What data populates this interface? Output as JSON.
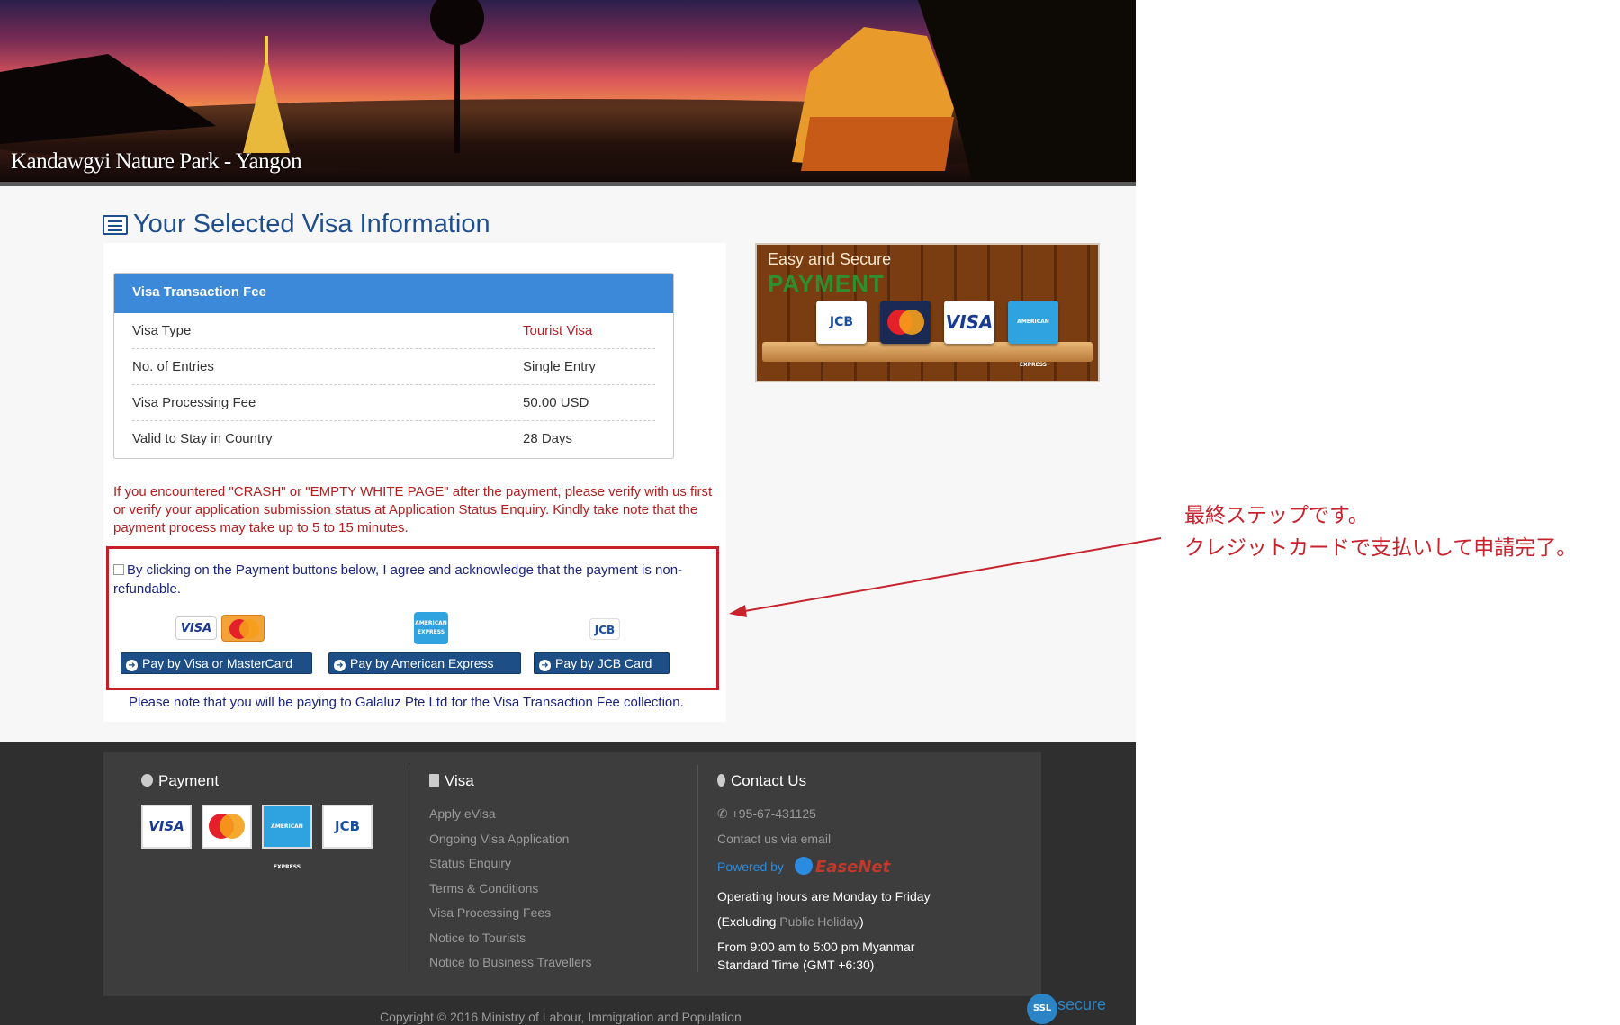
{
  "banner": {
    "caption": "Kandawgyi Nature Park - Yangon"
  },
  "section": {
    "title": "Your Selected Visa Information"
  },
  "fee_table": {
    "header": "Visa Transaction Fee",
    "rows": [
      {
        "label": "Visa Type",
        "value": "Tourist Visa"
      },
      {
        "label": "No. of Entries",
        "value": "Single Entry"
      },
      {
        "label": "Visa Processing Fee",
        "value": "50.00 USD"
      },
      {
        "label": "Valid to Stay in Country",
        "value": "28 Days"
      }
    ]
  },
  "warning_text": "If you encountered \"CRASH\" or \"EMPTY WHITE PAGE\" after the payment, please verify with us first or verify your application submission status at Application Status Enquiry. Kindly take note that the payment process may take up to 5 to 15 minutes.",
  "agreement_text": "By clicking on the Payment buttons below, I agree and acknowledge that the payment is non-refundable.",
  "payment": {
    "logos": {
      "visa": "VISA",
      "mastercard": "MasterCard",
      "amex": "AMERICAN EXPRESS",
      "jcb": "JCB"
    },
    "buttons": [
      {
        "label": "Pay by Visa or MasterCard"
      },
      {
        "label": "Pay by American Express"
      },
      {
        "label": "Pay by JCB Card"
      }
    ]
  },
  "note_text": "Please note that you will be paying to Galaluz Pte Ltd for the Visa Transaction Fee collection.",
  "ad": {
    "line1": "Easy and Secure",
    "line2": "PAYMENT",
    "cards": [
      "JCB",
      "MasterCard",
      "VISA",
      "AMERICAN EXPRESS"
    ]
  },
  "annotation": {
    "line1": "最終ステップです。",
    "line2": "クレジットカードで支払いして申請完了。",
    "color": "#c8222d"
  },
  "footer": {
    "payment_title": "Payment",
    "payment_cards": [
      "VISA",
      "MasterCard",
      "AMERICAN EXPRESS",
      "JCB"
    ],
    "visa_title": "Visa",
    "visa_links": [
      "Apply eVisa",
      "Ongoing Visa Application",
      "Status Enquiry",
      "Terms & Conditions",
      "Visa Processing Fees",
      "Notice to Tourists",
      "Notice to Business Travellers"
    ],
    "contact_title": "Contact Us",
    "phone": "+95-67-431125",
    "email_link": "Contact us via email",
    "powered_by": "Powered by",
    "powered_brand": "EaseNet",
    "hours_line1": "Operating hours are Monday to Friday",
    "hours_line2_pre": "(Excluding ",
    "hours_line2_link": "Public Holiday",
    "hours_line2_post": ")",
    "hours_line3": "From 9:00 am to 5:00 pm Myanmar Standard Time (GMT +6:30)",
    "copyright": "Copyright © 2016  Ministry of Labour, Immigration and Population",
    "ssl_badge": "SSL",
    "ssl_word": "secure"
  },
  "colors": {
    "accent_blue": "#3b89d8",
    "button_blue": "#1d4f86",
    "warning_red": "#b31e1e",
    "link_navy": "#1a237e"
  }
}
